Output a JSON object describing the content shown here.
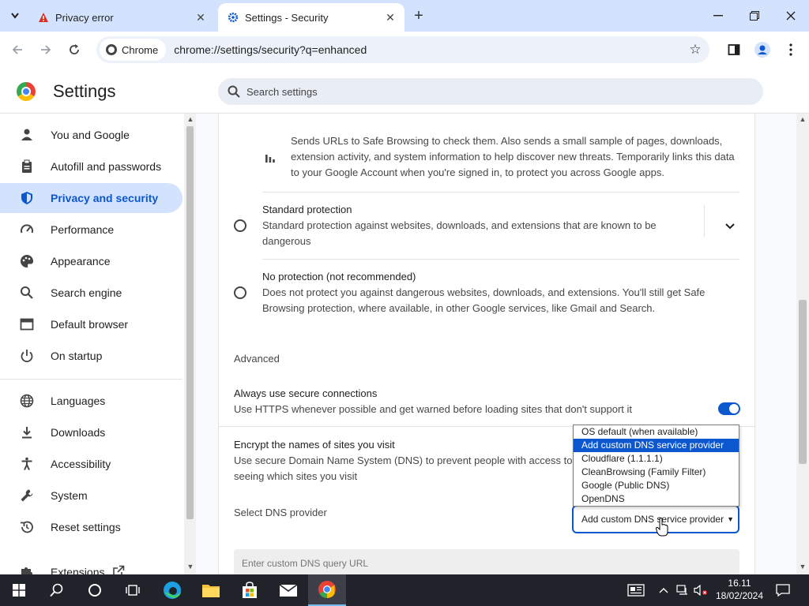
{
  "browser": {
    "tabs": [
      {
        "label": "Privacy error",
        "active": false
      },
      {
        "label": "Settings - Security",
        "active": true
      }
    ],
    "chip_label": "Chrome",
    "url": "chrome://settings/security?q=enhanced"
  },
  "header": {
    "title": "Settings",
    "search_placeholder": "Search settings"
  },
  "sidebar": {
    "items": [
      {
        "label": "You and Google",
        "icon": "person-icon"
      },
      {
        "label": "Autofill and passwords",
        "icon": "clipboard-icon"
      },
      {
        "label": "Privacy and security",
        "icon": "shield-icon",
        "active": true
      },
      {
        "label": "Performance",
        "icon": "speedometer-icon"
      },
      {
        "label": "Appearance",
        "icon": "palette-icon"
      },
      {
        "label": "Search engine",
        "icon": "search-icon"
      },
      {
        "label": "Default browser",
        "icon": "browser-window-icon"
      },
      {
        "label": "On startup",
        "icon": "power-icon"
      },
      {
        "label": "Languages",
        "icon": "globe-icon"
      },
      {
        "label": "Downloads",
        "icon": "download-icon"
      },
      {
        "label": "Accessibility",
        "icon": "accessibility-icon"
      },
      {
        "label": "System",
        "icon": "wrench-icon"
      },
      {
        "label": "Reset settings",
        "icon": "history-icon"
      },
      {
        "label": "Extensions",
        "icon": "puzzle-icon"
      }
    ]
  },
  "main": {
    "enhanced_desc": "Sends URLs to Safe Browsing to check them. Also sends a small sample of pages, downloads, extension activity, and system information to help discover new threats. Temporarily links this data to your Google Account when you're signed in, to protect you across Google apps.",
    "standard": {
      "title": "Standard protection",
      "desc": "Standard protection against websites, downloads, and extensions that are known to be dangerous"
    },
    "noprotect": {
      "title": "No protection (not recommended)",
      "desc": "Does not protect you against dangerous websites, downloads, and extensions. You'll still get Safe Browsing protection, where available, in other Google services, like Gmail and Search."
    },
    "advanced_heading": "Advanced",
    "https": {
      "title": "Always use secure connections",
      "desc": "Use HTTPS whenever possible and get warned before loading sites that don't support it",
      "enabled": true
    },
    "dns": {
      "title": "Encrypt the names of sites you visit",
      "desc_line1": "Use secure Domain Name System (DNS) to prevent people with access to y",
      "desc_line2": "seeing which sites you visit",
      "select_label": "Select DNS provider",
      "selected": "Add custom DNS service provider",
      "options": [
        "OS default (when available)",
        "Add custom DNS service provider",
        "Cloudflare (1.1.1.1)",
        "CleanBrowsing (Family Filter)",
        "Google (Public DNS)",
        "OpenDNS"
      ],
      "custom_placeholder": "Enter custom DNS query URL"
    }
  },
  "taskbar": {
    "time": "16.11",
    "date": "18/02/2024"
  },
  "colors": {
    "accent": "#0b57d0",
    "active_bg": "#d3e3fd",
    "taskbar": "#20232a"
  }
}
